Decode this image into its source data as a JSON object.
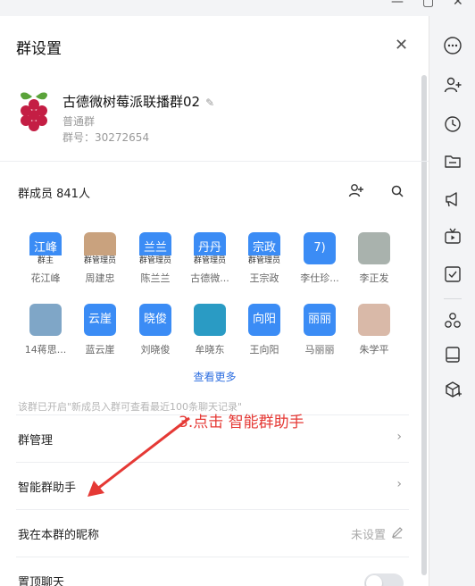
{
  "panel": {
    "title": "群设置",
    "close_glyph": "✕"
  },
  "group": {
    "name": "古德微树莓派联播群02",
    "type": "普通群",
    "number": "群号：30272654",
    "avatar_icon": "raspberry-pi-logo"
  },
  "members": {
    "header": "群成员 841人",
    "see_more": "查看更多",
    "list": [
      {
        "avatar_text": "江峰",
        "role": "群主",
        "name": "花江峰",
        "avatar_color": "#3b8cf5"
      },
      {
        "avatar_text": "",
        "role": "群管理员",
        "name": "周建忠",
        "avatar_color": "#c9a27e"
      },
      {
        "avatar_text": "兰兰",
        "role": "群管理员",
        "name": "陈兰兰",
        "avatar_color": "#3b8cf5"
      },
      {
        "avatar_text": "丹丹",
        "role": "群管理员",
        "name": "古德微...",
        "avatar_color": "#3b8cf5"
      },
      {
        "avatar_text": "宗政",
        "role": "群管理员",
        "name": "王宗政",
        "avatar_color": "#3b8cf5"
      },
      {
        "avatar_text": "7)",
        "role": "",
        "name": "李仕珍...",
        "avatar_color": "#3b8cf5"
      },
      {
        "avatar_text": "",
        "role": "",
        "name": "李正发",
        "avatar_color": "#a9b2ad"
      },
      {
        "avatar_text": "",
        "role": "",
        "name": "14蒋思...",
        "avatar_color": "#7fa6c7"
      },
      {
        "avatar_text": "云崖",
        "role": "",
        "name": "蓝云崖",
        "avatar_color": "#3b8cf5"
      },
      {
        "avatar_text": "晓俊",
        "role": "",
        "name": "刘晓俊",
        "avatar_color": "#3b8cf5"
      },
      {
        "avatar_text": "",
        "role": "",
        "name": "牟晓东",
        "avatar_color": "#2a9bc4"
      },
      {
        "avatar_text": "向阳",
        "role": "",
        "name": "王向阳",
        "avatar_color": "#3b8cf5"
      },
      {
        "avatar_text": "丽丽",
        "role": "",
        "name": "马丽丽",
        "avatar_color": "#3b8cf5"
      },
      {
        "avatar_text": "",
        "role": "",
        "name": "朱学平",
        "avatar_color": "#d9b9a8"
      }
    ]
  },
  "notice": "该群已开启\"新成员入群可查看最近100条聊天记录\"",
  "settings": {
    "manage": "群管理",
    "assistant": "智能群助手",
    "nickname_label": "我在本群的昵称",
    "nickname_value": "未设置",
    "pin_chat": "置顶聊天"
  },
  "annotation": "3.点击 智能群助手",
  "colors": {
    "accent": "#3b8cf5",
    "link": "#2f6fe0",
    "annotation": "#e53935"
  },
  "sidebar_icons": [
    "more-icon",
    "add-person-icon",
    "history-clock-icon",
    "folder-icon",
    "announcement-icon",
    "live-video-icon",
    "task-check-icon",
    "apps-icon",
    "notebook-icon",
    "cube-icon"
  ]
}
